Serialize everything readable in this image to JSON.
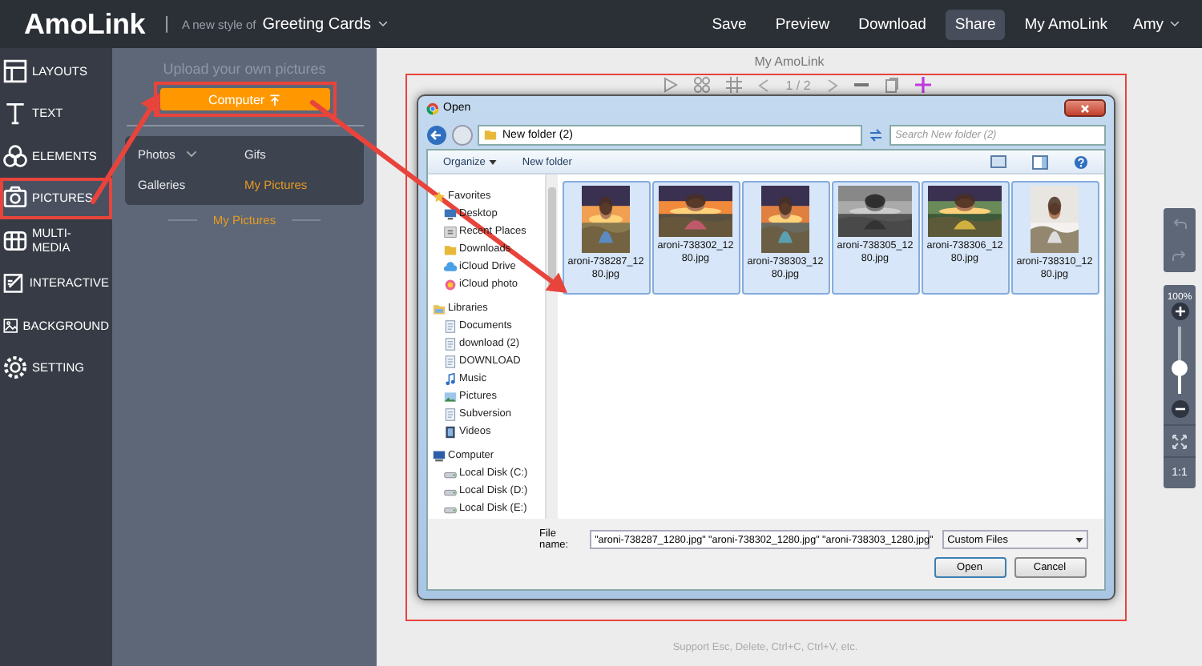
{
  "header": {
    "logo": "AmoLink",
    "divider": "|",
    "tagline": "A new style of",
    "product": "Greeting Cards",
    "actions": [
      {
        "label": "Save",
        "selected": false
      },
      {
        "label": "Preview",
        "selected": false
      },
      {
        "label": "Download",
        "selected": false
      },
      {
        "label": "Share",
        "selected": true
      }
    ],
    "account": "My AmoLink",
    "user": "Amy"
  },
  "sidebar": {
    "items": [
      {
        "label": "LAYOUTS",
        "kind": "layouts",
        "selected": false
      },
      {
        "label": "TEXT",
        "kind": "text",
        "selected": false
      },
      {
        "label": "ELEMENTS",
        "kind": "elements",
        "selected": false
      },
      {
        "label": "PICTURES",
        "kind": "pictures",
        "selected": true
      },
      {
        "label": "MULTI-MEDIA",
        "kind": "media",
        "selected": false
      },
      {
        "label": "INTERACTIVE",
        "kind": "interactive",
        "selected": false
      },
      {
        "label": "BACKGROUND",
        "kind": "background",
        "selected": false
      },
      {
        "label": "SETTING",
        "kind": "setting",
        "selected": false
      }
    ]
  },
  "panel": {
    "heading": "Upload your own pictures",
    "upload_button": "Computer",
    "tabs": [
      {
        "label": "Photos",
        "dropdown": true,
        "selected": false
      },
      {
        "label": "Gifs",
        "dropdown": false,
        "selected": false
      },
      {
        "label": "Galleries",
        "dropdown": false,
        "selected": false
      },
      {
        "label": "My Pictures",
        "dropdown": false,
        "selected": true
      }
    ],
    "section": "My Pictures"
  },
  "canvas": {
    "title": "My AmoLink",
    "pager": "1 / 2",
    "hint": "Support Esc, Delete, Ctrl+C, Ctrl+V, etc."
  },
  "zoom": {
    "reading": "100%",
    "level": 0.38,
    "reset": "1:1"
  },
  "dialog": {
    "title": "Open",
    "path": "New folder (2)",
    "search": {
      "placeholder": "Search New folder (2)"
    },
    "toolbar": [
      {
        "label": "Organize",
        "dropdown": true
      },
      {
        "label": "New folder",
        "dropdown": false
      }
    ],
    "nav": [
      {
        "label": "Favorites",
        "kind": "star",
        "children": [
          {
            "label": "Desktop",
            "kind": "desktop"
          },
          {
            "label": "Recent Places",
            "kind": "places"
          },
          {
            "label": "Downloads",
            "kind": "folder"
          },
          {
            "label": "iCloud Drive",
            "kind": "cloud"
          },
          {
            "label": "iCloud photo",
            "kind": "photos"
          }
        ]
      },
      {
        "label": "Libraries",
        "kind": "library",
        "children": [
          {
            "label": "Documents",
            "kind": "document"
          },
          {
            "label": "download (2)",
            "kind": "document"
          },
          {
            "label": "DOWNLOAD",
            "kind": "document"
          },
          {
            "label": "Music",
            "kind": "music"
          },
          {
            "label": "Pictures",
            "kind": "pictures"
          },
          {
            "label": "Subversion",
            "kind": "document"
          },
          {
            "label": "Videos",
            "kind": "video"
          }
        ]
      },
      {
        "label": "Computer",
        "kind": "computer",
        "children": [
          {
            "label": "Local Disk (C:)",
            "kind": "disk"
          },
          {
            "label": "Local Disk (D:)",
            "kind": "disk"
          },
          {
            "label": "Local Disk (E:)",
            "kind": "disk"
          }
        ]
      }
    ],
    "files": [
      {
        "name": "aroni-738287_1280.jpg",
        "selected": true
      },
      {
        "name": "aroni-738302_1280.jpg",
        "selected": true
      },
      {
        "name": "aroni-738303_1280.jpg",
        "selected": true
      },
      {
        "name": "aroni-738305_1280.jpg",
        "selected": true
      },
      {
        "name": "aroni-738306_1280.jpg",
        "selected": true
      },
      {
        "name": "aroni-738310_1280.jpg",
        "selected": true
      }
    ],
    "file_name_label": "File name:",
    "file_name": "\"aroni-738287_1280.jpg\" \"aroni-738302_1280.jpg\" \"aroni-738303_1280.jpg\"",
    "file_type": "Custom Files",
    "buttons": [
      {
        "label": "Open",
        "default": true
      },
      {
        "label": "Cancel",
        "default": false
      }
    ]
  }
}
